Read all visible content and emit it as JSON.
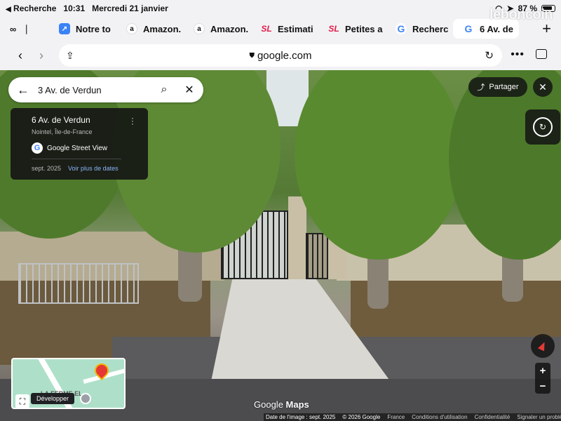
{
  "status": {
    "back_label": "Recherche",
    "time": "10:31",
    "date": "Mercredi 21 janvier",
    "battery": "87 %"
  },
  "tabs": [
    {
      "label": "",
      "icon": "reader-icon"
    },
    {
      "label": "Notre to",
      "icon": "blue-icon"
    },
    {
      "label": "Amazon.",
      "icon": "amazon-icon"
    },
    {
      "label": "Amazon.",
      "icon": "amazon-icon"
    },
    {
      "label": "Estimati",
      "icon": "sl-icon"
    },
    {
      "label": "Petites a",
      "icon": "sl-icon"
    },
    {
      "label": "Recherc",
      "icon": "google-icon"
    },
    {
      "label": "6 Av. de",
      "icon": "google-icon",
      "active": true
    }
  ],
  "watermark": "leboncoin",
  "browser": {
    "url": "google.com"
  },
  "search": {
    "query": "3 Av. de Verdun"
  },
  "info_card": {
    "address": "6 Av. de Verdun",
    "location": "Nointel, Île-de-France",
    "source": "Google Street View",
    "capture_date": "sept. 2025",
    "more_dates": "Voir plus de dates"
  },
  "share": {
    "label": "Partager"
  },
  "minimap": {
    "tooltip": "Développer",
    "label": "LA FERME   EL"
  },
  "branding": {
    "google": "Google",
    "maps": "Maps"
  },
  "footer": {
    "image_date": "Date de l'image : sept. 2025",
    "copyright": "© 2026 Google",
    "country": "France",
    "terms": "Conditions d'utilisation",
    "privacy": "Confidentialité",
    "report": "Signaler un problème"
  }
}
